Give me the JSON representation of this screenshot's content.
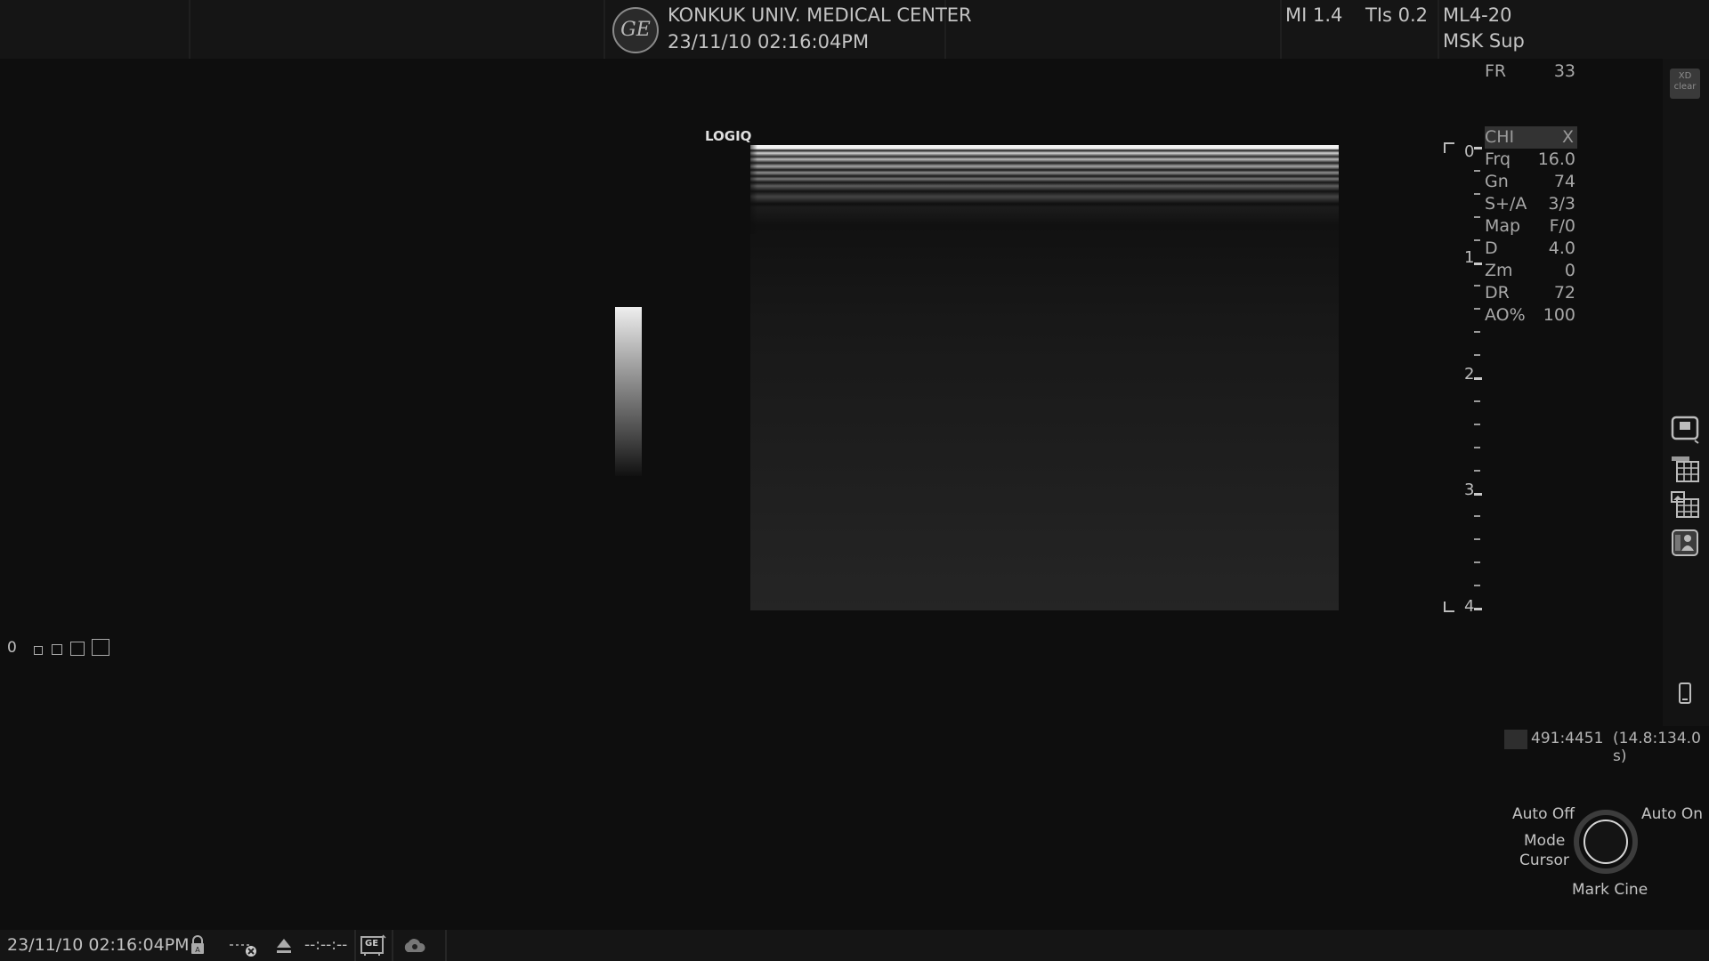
{
  "header": {
    "institution": "KONKUK UNIV. MEDICAL CENTER",
    "datetime": "23/11/10 02:16:04PM",
    "mi": "MI 1.4",
    "tis": "TIs 0.2",
    "probe": "ML4-20",
    "preset": "MSK Sup",
    "logo_text": "GE"
  },
  "image_label": "LOGIQ",
  "params": {
    "fr_key": "FR",
    "fr_val": "33",
    "chi_key": "CHI",
    "chi_val": "X",
    "rows": [
      {
        "k": "Frq",
        "v": "16.0"
      },
      {
        "k": "Gn",
        "v": "74"
      },
      {
        "k": "S+/A",
        "v": "3/3"
      },
      {
        "k": "Map",
        "v": "F/0"
      },
      {
        "k": "D",
        "v": "4.0"
      },
      {
        "k": "Zm",
        "v": "0"
      },
      {
        "k": "DR",
        "v": "72"
      },
      {
        "k": "AO%",
        "v": "100"
      }
    ]
  },
  "depth_scale": [
    "0",
    "1",
    "2",
    "3",
    "4"
  ],
  "zoom_indicator": "0",
  "cine": {
    "frames": "491:4451",
    "time": "(14.8:134.0 s)"
  },
  "knob": {
    "auto_off": "Auto Off",
    "auto_on": "Auto On",
    "mode": "Mode",
    "cursor": "Cursor",
    "mark_cine": "Mark Cine"
  },
  "xd_clear": [
    "XD",
    "clear"
  ],
  "status_bar": {
    "datetime": "23/11/10 02:16:04PM",
    "timer": "--:--:--",
    "ge_badge": "GE"
  },
  "icons": {
    "lock": "lock-icon",
    "network": "network-disconnected-icon",
    "eject": "eject-icon",
    "ge_device": "ge-device-icon",
    "cloud": "cloud-icon",
    "monitor": "monitor-icon",
    "worksheet": "worksheet-table-icon",
    "image_table": "image-table-icon",
    "patient": "patient-icon",
    "mobile": "mobile-device-icon"
  }
}
